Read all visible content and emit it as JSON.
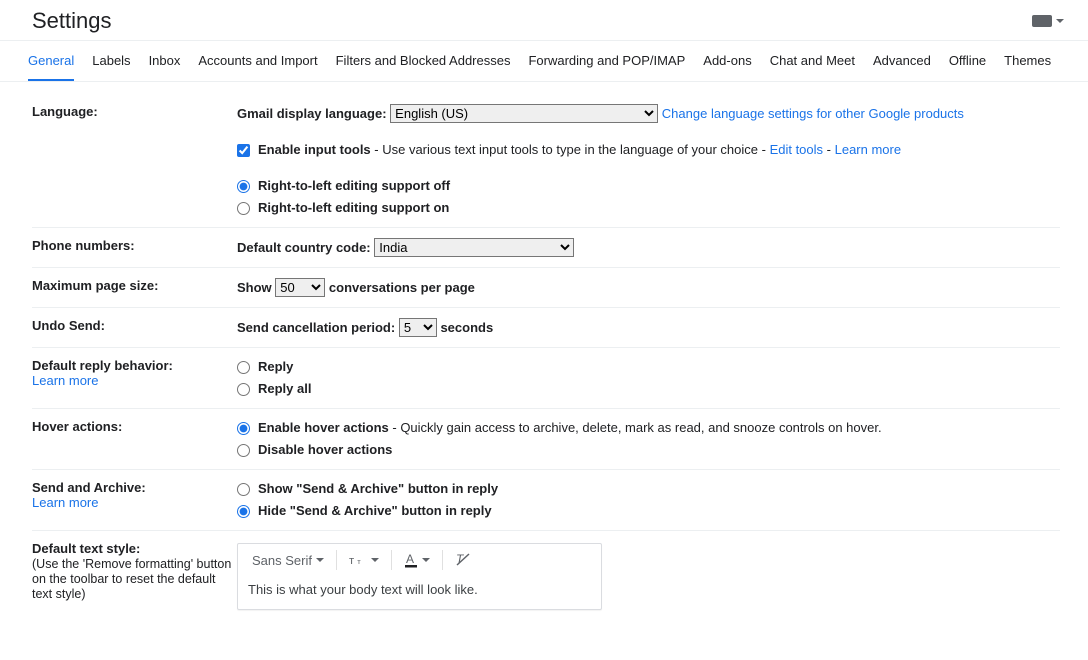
{
  "header": {
    "title": "Settings"
  },
  "tabs": [
    "General",
    "Labels",
    "Inbox",
    "Accounts and Import",
    "Filters and Blocked Addresses",
    "Forwarding and POP/IMAP",
    "Add-ons",
    "Chat and Meet",
    "Advanced",
    "Offline",
    "Themes"
  ],
  "language": {
    "heading": "Language:",
    "display_label": "Gmail display language:",
    "display_value": "English (US)",
    "change_link": "Change language settings for other Google products",
    "enable_input_tools": "Enable input tools",
    "enable_input_desc": " - Use various text input tools to type in the language of your choice - ",
    "edit_tools": "Edit tools",
    "dash": " - ",
    "learn_more": "Learn more",
    "rtl_off": "Right-to-left editing support off",
    "rtl_on": "Right-to-left editing support on"
  },
  "phone": {
    "heading": "Phone numbers:",
    "label": "Default country code:",
    "value": "India"
  },
  "page_size": {
    "heading": "Maximum page size:",
    "show": "Show",
    "value": "50",
    "suffix": "conversations per page"
  },
  "undo": {
    "heading": "Undo Send:",
    "label": "Send cancellation period:",
    "value": "5",
    "suffix": "seconds"
  },
  "reply": {
    "heading": "Default reply behavior:",
    "learn_more": "Learn more",
    "opt1": "Reply",
    "opt2": "Reply all"
  },
  "hover": {
    "heading": "Hover actions:",
    "enable": "Enable hover actions",
    "enable_desc": " - Quickly gain access to archive, delete, mark as read, and snooze controls on hover.",
    "disable": "Disable hover actions"
  },
  "send_archive": {
    "heading": "Send and Archive:",
    "learn_more": "Learn more",
    "show": "Show \"Send & Archive\" button in reply",
    "hide": "Hide \"Send & Archive\" button in reply"
  },
  "text_style": {
    "heading": "Default text style:",
    "note": "(Use the 'Remove formatting' button on the toolbar to reset the default text style)",
    "font_name": "Sans Serif",
    "preview": "This is what your body text will look like."
  }
}
